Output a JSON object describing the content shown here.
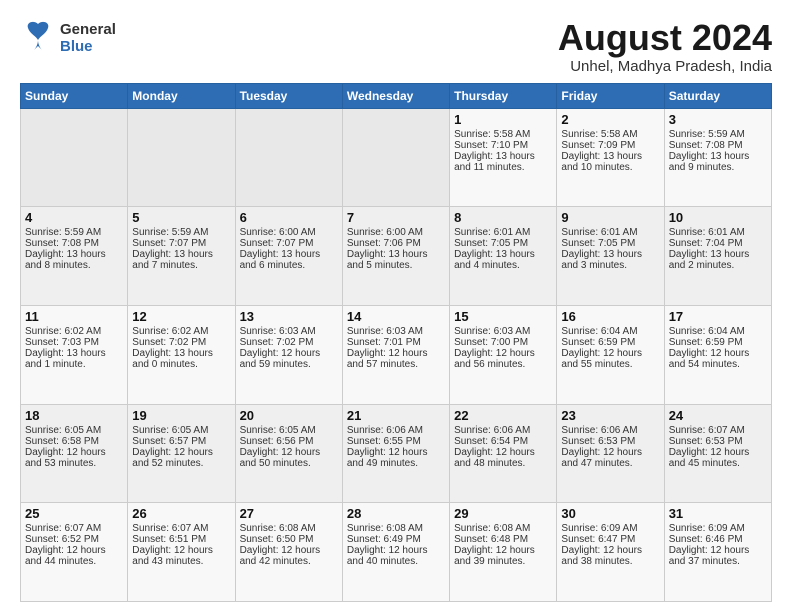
{
  "header": {
    "logo_general": "General",
    "logo_blue": "Blue",
    "month_title": "August 2024",
    "location": "Unhel, Madhya Pradesh, India"
  },
  "days_of_week": [
    "Sunday",
    "Monday",
    "Tuesday",
    "Wednesday",
    "Thursday",
    "Friday",
    "Saturday"
  ],
  "weeks": [
    [
      {
        "day": "",
        "content": ""
      },
      {
        "day": "",
        "content": ""
      },
      {
        "day": "",
        "content": ""
      },
      {
        "day": "",
        "content": ""
      },
      {
        "day": "1",
        "content": "Sunrise: 5:58 AM\nSunset: 7:10 PM\nDaylight: 13 hours and 11 minutes."
      },
      {
        "day": "2",
        "content": "Sunrise: 5:58 AM\nSunset: 7:09 PM\nDaylight: 13 hours and 10 minutes."
      },
      {
        "day": "3",
        "content": "Sunrise: 5:59 AM\nSunset: 7:08 PM\nDaylight: 13 hours and 9 minutes."
      }
    ],
    [
      {
        "day": "4",
        "content": "Sunrise: 5:59 AM\nSunset: 7:08 PM\nDaylight: 13 hours and 8 minutes."
      },
      {
        "day": "5",
        "content": "Sunrise: 5:59 AM\nSunset: 7:07 PM\nDaylight: 13 hours and 7 minutes."
      },
      {
        "day": "6",
        "content": "Sunrise: 6:00 AM\nSunset: 7:07 PM\nDaylight: 13 hours and 6 minutes."
      },
      {
        "day": "7",
        "content": "Sunrise: 6:00 AM\nSunset: 7:06 PM\nDaylight: 13 hours and 5 minutes."
      },
      {
        "day": "8",
        "content": "Sunrise: 6:01 AM\nSunset: 7:05 PM\nDaylight: 13 hours and 4 minutes."
      },
      {
        "day": "9",
        "content": "Sunrise: 6:01 AM\nSunset: 7:05 PM\nDaylight: 13 hours and 3 minutes."
      },
      {
        "day": "10",
        "content": "Sunrise: 6:01 AM\nSunset: 7:04 PM\nDaylight: 13 hours and 2 minutes."
      }
    ],
    [
      {
        "day": "11",
        "content": "Sunrise: 6:02 AM\nSunset: 7:03 PM\nDaylight: 13 hours and 1 minute."
      },
      {
        "day": "12",
        "content": "Sunrise: 6:02 AM\nSunset: 7:02 PM\nDaylight: 13 hours and 0 minutes."
      },
      {
        "day": "13",
        "content": "Sunrise: 6:03 AM\nSunset: 7:02 PM\nDaylight: 12 hours and 59 minutes."
      },
      {
        "day": "14",
        "content": "Sunrise: 6:03 AM\nSunset: 7:01 PM\nDaylight: 12 hours and 57 minutes."
      },
      {
        "day": "15",
        "content": "Sunrise: 6:03 AM\nSunset: 7:00 PM\nDaylight: 12 hours and 56 minutes."
      },
      {
        "day": "16",
        "content": "Sunrise: 6:04 AM\nSunset: 6:59 PM\nDaylight: 12 hours and 55 minutes."
      },
      {
        "day": "17",
        "content": "Sunrise: 6:04 AM\nSunset: 6:59 PM\nDaylight: 12 hours and 54 minutes."
      }
    ],
    [
      {
        "day": "18",
        "content": "Sunrise: 6:05 AM\nSunset: 6:58 PM\nDaylight: 12 hours and 53 minutes."
      },
      {
        "day": "19",
        "content": "Sunrise: 6:05 AM\nSunset: 6:57 PM\nDaylight: 12 hours and 52 minutes."
      },
      {
        "day": "20",
        "content": "Sunrise: 6:05 AM\nSunset: 6:56 PM\nDaylight: 12 hours and 50 minutes."
      },
      {
        "day": "21",
        "content": "Sunrise: 6:06 AM\nSunset: 6:55 PM\nDaylight: 12 hours and 49 minutes."
      },
      {
        "day": "22",
        "content": "Sunrise: 6:06 AM\nSunset: 6:54 PM\nDaylight: 12 hours and 48 minutes."
      },
      {
        "day": "23",
        "content": "Sunrise: 6:06 AM\nSunset: 6:53 PM\nDaylight: 12 hours and 47 minutes."
      },
      {
        "day": "24",
        "content": "Sunrise: 6:07 AM\nSunset: 6:53 PM\nDaylight: 12 hours and 45 minutes."
      }
    ],
    [
      {
        "day": "25",
        "content": "Sunrise: 6:07 AM\nSunset: 6:52 PM\nDaylight: 12 hours and 44 minutes."
      },
      {
        "day": "26",
        "content": "Sunrise: 6:07 AM\nSunset: 6:51 PM\nDaylight: 12 hours and 43 minutes."
      },
      {
        "day": "27",
        "content": "Sunrise: 6:08 AM\nSunset: 6:50 PM\nDaylight: 12 hours and 42 minutes."
      },
      {
        "day": "28",
        "content": "Sunrise: 6:08 AM\nSunset: 6:49 PM\nDaylight: 12 hours and 40 minutes."
      },
      {
        "day": "29",
        "content": "Sunrise: 6:08 AM\nSunset: 6:48 PM\nDaylight: 12 hours and 39 minutes."
      },
      {
        "day": "30",
        "content": "Sunrise: 6:09 AM\nSunset: 6:47 PM\nDaylight: 12 hours and 38 minutes."
      },
      {
        "day": "31",
        "content": "Sunrise: 6:09 AM\nSunset: 6:46 PM\nDaylight: 12 hours and 37 minutes."
      }
    ]
  ]
}
